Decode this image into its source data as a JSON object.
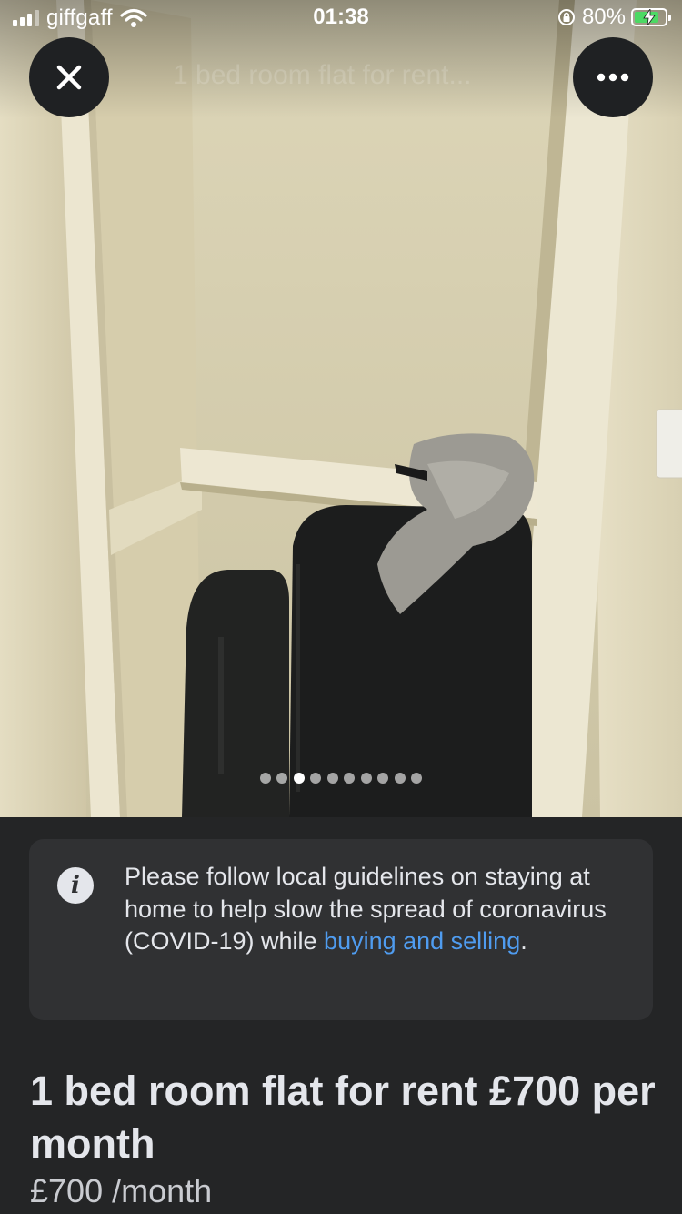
{
  "status_bar": {
    "carrier": "giffgaff",
    "time": "01:38",
    "battery_percent": "80%",
    "battery_level": 0.8
  },
  "header": {
    "ghost_title": "1 bed room flat for rent...",
    "close_icon": "close-icon",
    "more_icon": "more-horizontal-icon"
  },
  "gallery": {
    "photo_count": 10,
    "active_index": 2
  },
  "notice": {
    "icon": "info-icon",
    "text_before": "Please follow local guidelines on staying at home to help slow the spread of coronavirus (COVID-19) while ",
    "link_text": "buying and selling",
    "text_after": "."
  },
  "listing": {
    "title": "1 bed room flat for rent £700 per month",
    "price": "£700",
    "price_period": "/month"
  },
  "colors": {
    "background": "#242526",
    "card": "#303133",
    "text": "#e4e6eb",
    "link": "#4f9cf0",
    "button_bg": "#1f2123"
  }
}
